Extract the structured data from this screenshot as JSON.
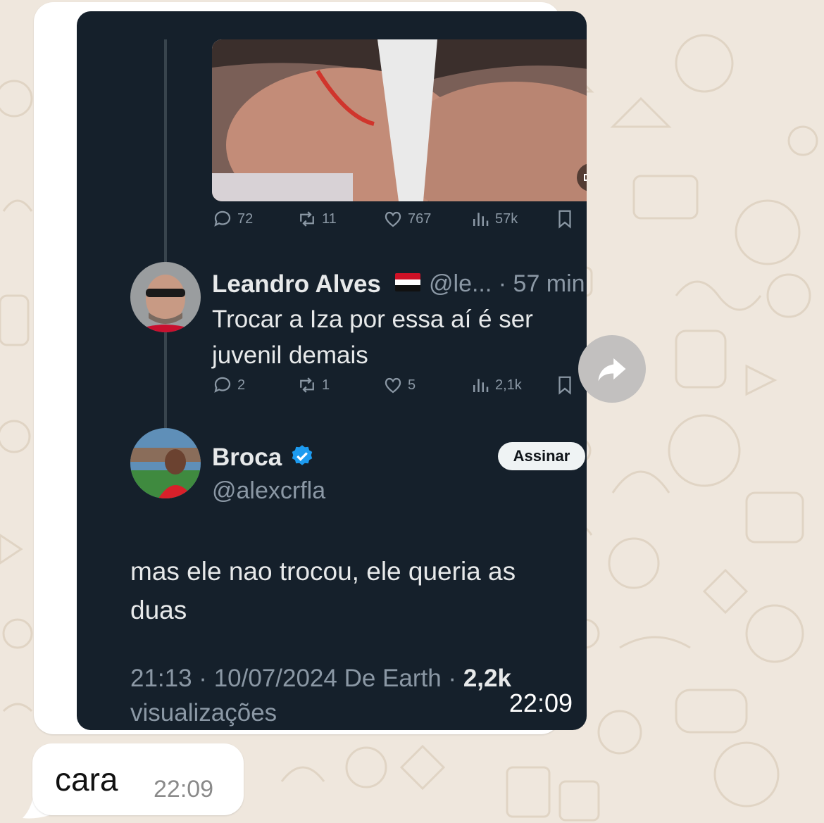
{
  "chat": {
    "forwarded_screenshot": {
      "first_post": {
        "stats": {
          "replies": "72",
          "reposts": "11",
          "likes": "767",
          "views": "57k"
        }
      },
      "reply": {
        "author_name": "Leandro Alves",
        "flag": "🇾🇪",
        "handle_time": "@le... · 57 min",
        "text_line1": "Trocar a Iza por essa aí é ser",
        "text_line2": "juvenil demais",
        "stats": {
          "replies": "2",
          "reposts": "1",
          "likes": "5",
          "views": "2,1k"
        }
      },
      "main_post": {
        "author_name": "Broca",
        "handle": "@alexcrfla",
        "follow_label": "Assinar",
        "text_line1": "mas ele nao trocou, ele queria as",
        "text_line2": "duas",
        "timestamp": "21:13 · 10/07/2024 De Earth · ",
        "views_count": "2,2k",
        "views_label": "visualizações"
      },
      "overlay_time": "22:09"
    },
    "text_message": {
      "text": "cara",
      "time": "22:09"
    }
  },
  "colors": {
    "chat_background": "#efe7dd",
    "x_dark_background": "#15202b",
    "verified_blue": "#1d9bf0",
    "muted_text": "#8b98a5"
  },
  "icons": [
    "reply-icon",
    "repost-icon",
    "like-icon",
    "views-icon",
    "bookmark-icon",
    "share-icon",
    "mute-icon",
    "verified-badge-icon",
    "more-icon",
    "forward-icon"
  ]
}
